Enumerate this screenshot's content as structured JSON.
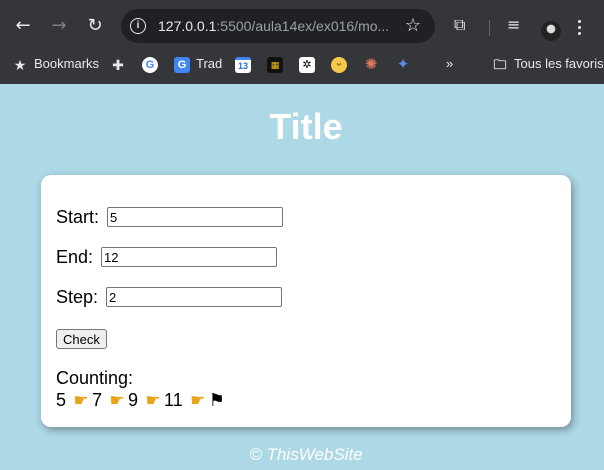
{
  "browser": {
    "url_host": "127.0.0.1",
    "url_rest": ":5500/aula14ex/ex016/mo...",
    "bookmarks": [
      {
        "label": "Bookmarks",
        "icon": "star-icon"
      },
      {
        "label": "",
        "icon": "puzzle-icon"
      },
      {
        "label": "",
        "icon": "google-icon"
      },
      {
        "label": "Trad",
        "icon": "translate-icon"
      },
      {
        "label": "13",
        "icon": "calendar-icon"
      },
      {
        "label": "",
        "icon": "game-icon"
      },
      {
        "label": "",
        "icon": "chatgpt-icon"
      },
      {
        "label": "",
        "icon": "emoji-icon"
      },
      {
        "label": "",
        "icon": "claude-icon"
      },
      {
        "label": "",
        "icon": "gemini-icon"
      }
    ],
    "overflow_label": "»",
    "folder_label": "Tous les favoris"
  },
  "page": {
    "title": "Title",
    "start_label": "Start:",
    "start_value": "5",
    "end_label": "End:",
    "end_value": "12",
    "step_label": "Step:",
    "step_value": "2",
    "check_label": "Check",
    "counting_label": "Counting:",
    "counting_values": [
      "5",
      "7",
      "9",
      "11"
    ],
    "footer": "© ThisWebSite"
  },
  "colors": {
    "background": "#add8e6",
    "card": "#ffffff",
    "chrome": "#35363a"
  }
}
